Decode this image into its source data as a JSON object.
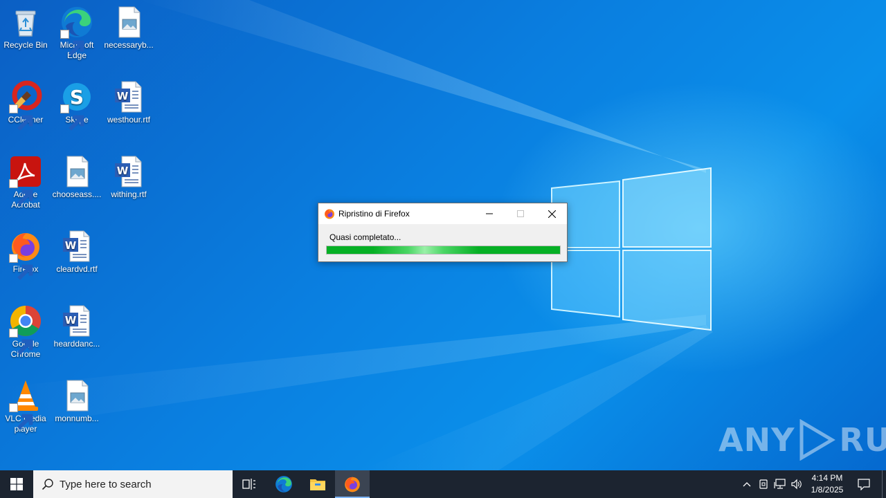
{
  "desktop": {
    "icons": [
      {
        "label": "Recycle Bin",
        "icon": "recycle-bin-icon"
      },
      {
        "label": "Microsoft Edge",
        "icon": "edge-icon"
      },
      {
        "label": "necessaryb...",
        "icon": "image-file-icon"
      },
      {
        "label": "CCleaner",
        "icon": "ccleaner-icon"
      },
      {
        "label": "Skype",
        "icon": "skype-icon"
      },
      {
        "label": "westhour.rtf",
        "icon": "word-doc-icon"
      },
      {
        "label": "Adobe Acrobat",
        "icon": "acrobat-icon"
      },
      {
        "label": "chooseass....",
        "icon": "image-file-icon"
      },
      {
        "label": "withing.rtf",
        "icon": "word-doc-icon"
      },
      {
        "label": "Firefox",
        "icon": "firefox-icon"
      },
      {
        "label": "cleardvd.rtf",
        "icon": "word-doc-icon"
      },
      {
        "label": "Google Chrome",
        "icon": "chrome-icon"
      },
      {
        "label": "hearddanc...",
        "icon": "word-doc-icon"
      },
      {
        "label": "VLC media player",
        "icon": "vlc-icon"
      },
      {
        "label": "monnumb...",
        "icon": "image-file-icon"
      }
    ]
  },
  "dialog": {
    "title": "Ripristino di Firefox",
    "status": "Quasi completato...",
    "progress_fraction": 1.0,
    "progress_color": "#06b025"
  },
  "watermark": {
    "left": "ANY",
    "right": "RUN"
  },
  "taskbar": {
    "search_placeholder": "Type here to search",
    "time": "4:14 PM",
    "date": "1/8/2025",
    "pinned": [
      "task-view-icon",
      "edge-icon",
      "file-explorer-icon",
      "firefox-icon"
    ],
    "active_app": "firefox"
  }
}
